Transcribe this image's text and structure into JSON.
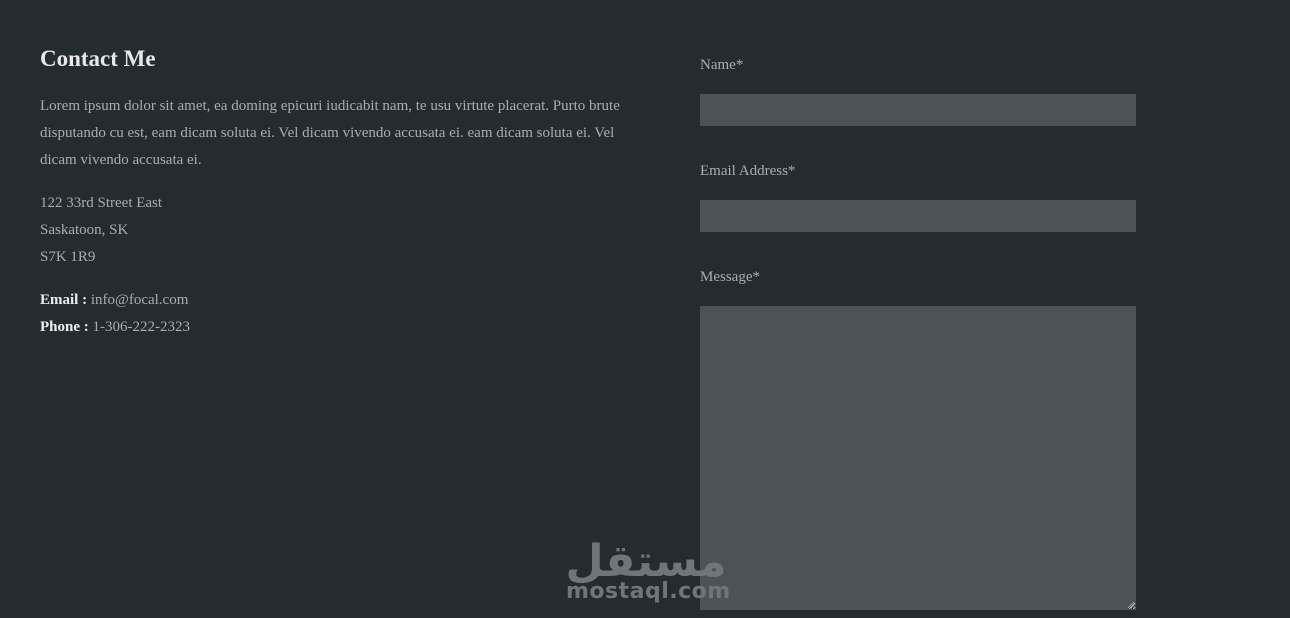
{
  "contact": {
    "title": "Contact Me",
    "intro": "Lorem ipsum dolor sit amet, ea doming epicuri iudicabit nam, te usu virtute placerat. Purto brute disputando cu est, eam dicam soluta ei. Vel dicam vivendo accusata ei. eam dicam soluta ei. Vel dicam vivendo accusata ei.",
    "address": {
      "line1": "122 33rd Street East",
      "line2": "Saskatoon, SK",
      "line3": "S7K 1R9"
    },
    "email_label": "Email :",
    "email_value": "info@focal.com",
    "phone_label": "Phone :",
    "phone_value": "1-306-222-2323"
  },
  "form": {
    "name_label": "Name*",
    "name_value": "",
    "email_label": "Email Address*",
    "email_value": "",
    "message_label": "Message*",
    "message_value": ""
  },
  "watermark": {
    "arabic_text": "مستقل",
    "latin_text": "mostaql.com"
  },
  "colors": {
    "background": "#252c30",
    "input_background": "#4b5356",
    "heading_text": "#e6e8e9",
    "body_text": "#a7adb0",
    "watermark": "#6f7679"
  }
}
